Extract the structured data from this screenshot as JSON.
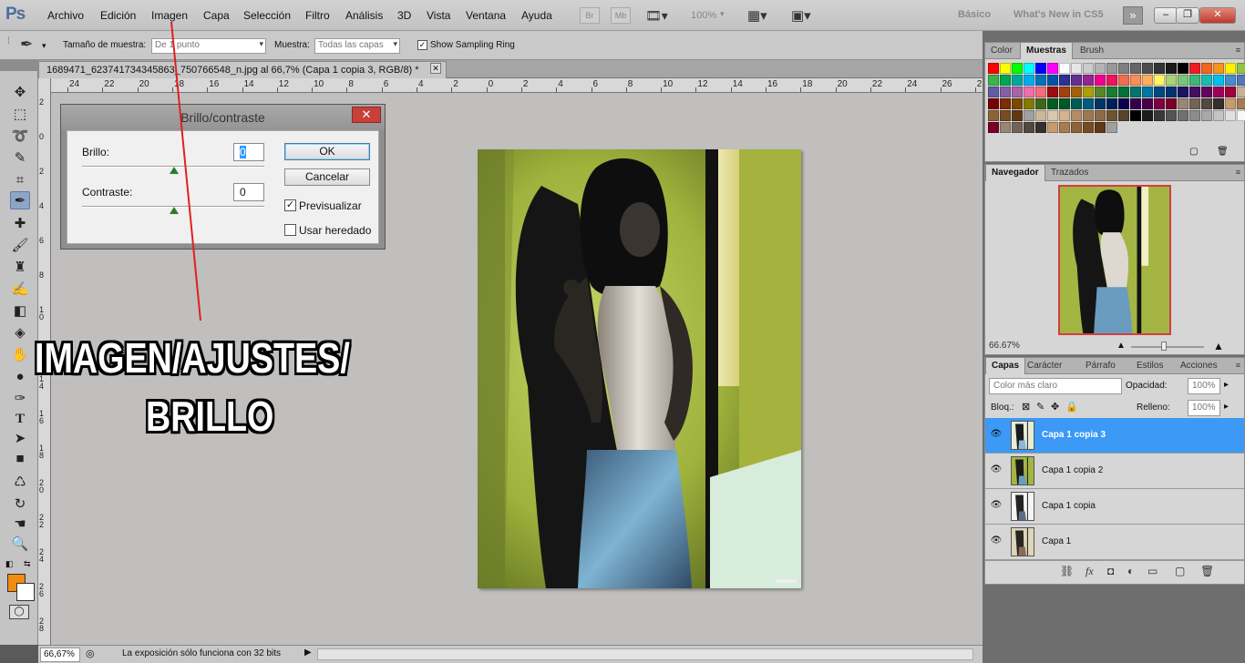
{
  "app": {
    "logo": "Ps",
    "menus": [
      "Archivo",
      "Edición",
      "Imagen",
      "Capa",
      "Selección",
      "Filtro",
      "Análisis",
      "3D",
      "Vista",
      "Ventana",
      "Ayuda"
    ],
    "mini_bridge": [
      "Br",
      "Mb"
    ],
    "zoom_level": "100%",
    "workspaces": [
      "Básico",
      "What's New in CS5"
    ],
    "window_buttons": [
      "–",
      "❐",
      "✕"
    ]
  },
  "options_bar": {
    "sample_size_label": "Tamaño de muestra:",
    "sample_size_value": "De 1 punto",
    "sample_label": "Muestra:",
    "sample_value": "Todas las capas",
    "sampling_ring_label": "Show Sampling Ring",
    "sampling_ring_checked": true
  },
  "document": {
    "tab_title": "1689471_623741734345863_750766548_n.jpg al 66,7% (Capa 1 copia 3, RGB/8) *",
    "h_ruler": [
      "24",
      "22",
      "20",
      "18",
      "16",
      "14",
      "12",
      "10",
      "8",
      "6",
      "4",
      "2",
      "0",
      "2",
      "4",
      "6",
      "8",
      "10",
      "12",
      "14",
      "16",
      "18",
      "20",
      "22",
      "24",
      "26",
      "28"
    ],
    "v_ruler": [
      "2",
      "0",
      "2",
      "4",
      "6",
      "8",
      "1 0",
      "1 2",
      "1 4",
      "1 6",
      "1 8",
      "2 0",
      "2 2",
      "2 4",
      "2 6",
      "2 8"
    ]
  },
  "dialog": {
    "title": "Brillo/contraste",
    "brightness_label": "Brillo:",
    "brightness_value": "0",
    "contrast_label": "Contraste:",
    "contrast_value": "0",
    "ok_label": "OK",
    "cancel_label": "Cancelar",
    "preview_label": "Previsualizar",
    "preview_checked": true,
    "legacy_label": "Usar heredado",
    "legacy_checked": false
  },
  "annotation": {
    "line1": "IMAGEN/AJUSTES/",
    "line2": "BRILLO"
  },
  "status_bar": {
    "zoom": "66,67%",
    "message": "La exposición sólo funciona con 32 bits"
  },
  "panels": {
    "swatches_tabs": [
      "Color",
      "Muestras",
      "Brush"
    ],
    "swatches_active": "Muestras",
    "swatch_colors": [
      "#ff0000",
      "#ffff00",
      "#00ff00",
      "#00ffff",
      "#0000ff",
      "#ff00ff",
      "#ffffff",
      "#e6e6e6",
      "#cccccc",
      "#b3b3b3",
      "#999999",
      "#808080",
      "#666666",
      "#4d4d4d",
      "#333333",
      "#1a1a1a",
      "#000000",
      "#ee1d24",
      "#f26522",
      "#f7941d",
      "#fff200",
      "#8dc63f",
      "#39b54a",
      "#00a651",
      "#00a99d",
      "#00aeef",
      "#0072bc",
      "#0054a6",
      "#2e3192",
      "#662d91",
      "#92278f",
      "#ec008c",
      "#ed145b",
      "#f26c4f",
      "#f68e56",
      "#fbaf5d",
      "#fff568",
      "#acd373",
      "#7cc576",
      "#3cb878",
      "#1abbb4",
      "#00bff3",
      "#448ccb",
      "#5674b9",
      "#605ca8",
      "#8560a8",
      "#a864a8",
      "#f06eaa",
      "#f26d7d",
      "#9e0b0f",
      "#a0410d",
      "#a36209",
      "#aba000",
      "#598527",
      "#197b30",
      "#007236",
      "#00746b",
      "#0076a3",
      "#004a80",
      "#003471",
      "#1b1464",
      "#440e62",
      "#630460",
      "#9e005d",
      "#9e0039",
      "#c7b299",
      "#790000",
      "#7b2e00",
      "#7d4900",
      "#827b00",
      "#406618",
      "#005e20",
      "#005826",
      "#005952",
      "#005b7f",
      "#003663",
      "#002157",
      "#0d004c",
      "#32004b",
      "#4b0049",
      "#7b0046",
      "#7a0026",
      "#998675",
      "#736357",
      "#534741",
      "#362f2d",
      "#c69c6d",
      "#a67c52",
      "#8c6239",
      "#754c24",
      "#603913",
      "#a0a0a0",
      "#cbb89a",
      "#d8c8b0",
      "#d4b48c",
      "#b48c64",
      "#9c7850",
      "#8a6b46",
      "#6f5331",
      "#58422a",
      "#000000",
      "#1c1c1c",
      "#383838",
      "#545454",
      "#707070",
      "#8c8c8c",
      "#a8a8a8",
      "#c4c4c4",
      "#e0e0e0",
      "#f8f8f8",
      "#7a0026",
      "#998675",
      "#736357",
      "#534741",
      "#362f2d",
      "#c69c6d",
      "#a67c52",
      "#8c6239",
      "#754c24",
      "#603913",
      "#a0a0a0"
    ],
    "navigator_tabs": [
      "Navegador",
      "Trazados"
    ],
    "navigator_active": "Navegador",
    "navigator_zoom": "66.67%",
    "layers_tabs": [
      "Capas",
      "Carácter",
      "Párrafo",
      "Estilos",
      "Acciones"
    ],
    "layers_active": "Capas",
    "blend_mode": "Color más claro",
    "opacity_label": "Opacidad:",
    "opacity_value": "100%",
    "lock_label": "Bloq.:",
    "fill_label": "Relleno:",
    "fill_value": "100%",
    "layers": [
      {
        "name": "Capa 1 copia 3",
        "selected": true
      },
      {
        "name": "Capa 1 copia 2",
        "selected": false
      },
      {
        "name": "Capa 1 copia",
        "selected": false
      },
      {
        "name": "Capa 1",
        "selected": false
      }
    ]
  }
}
